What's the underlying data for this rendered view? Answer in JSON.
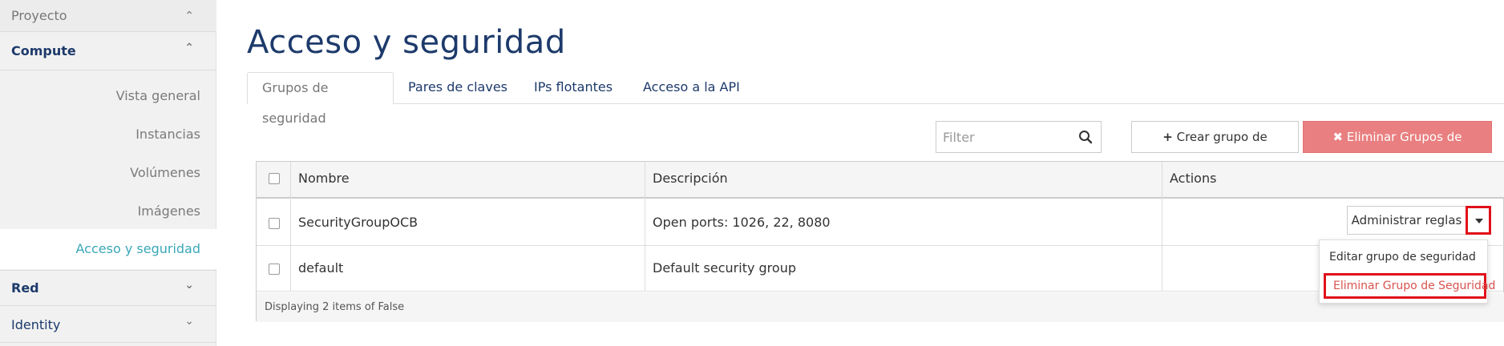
{
  "sidebar": {
    "top_section": "Proyecto",
    "compute": {
      "label": "Compute"
    },
    "items": [
      {
        "label": "Vista general"
      },
      {
        "label": "Instancias"
      },
      {
        "label": "Volúmenes"
      },
      {
        "label": "Imágenes"
      },
      {
        "label": "Acceso y seguridad",
        "active": true
      }
    ],
    "red": {
      "label": "Red"
    },
    "identity": {
      "label": "Identity"
    }
  },
  "main": {
    "title": "Acceso y seguridad",
    "tabs": [
      {
        "label": "Grupos de seguridad",
        "active": true
      },
      {
        "label": "Pares de claves"
      },
      {
        "label": "IPs flotantes"
      },
      {
        "label": "Acceso a la API"
      }
    ],
    "toolbar": {
      "filter_placeholder": "Filter",
      "create_label": "Crear grupo de seguridad",
      "delete_label": "Eliminar Grupos de Seguridad"
    },
    "table": {
      "columns": [
        "Nombre",
        "Descripción",
        "Actions"
      ],
      "rows": [
        {
          "name": "SecurityGroupOCB",
          "description": "Open ports: 1026, 22, 8080"
        },
        {
          "name": "default",
          "description": "Default security group"
        }
      ],
      "footer": "Displaying 2 items of False"
    },
    "actions": {
      "primary_label": "Administrar reglas",
      "menu": [
        {
          "label": "Editar grupo de seguridad"
        },
        {
          "label": "Eliminar Grupo de Seguridad"
        }
      ]
    }
  },
  "colors": {
    "brand_navy": "#1d3a6b",
    "active_teal": "#3aa7b8",
    "danger_button": "#e97f80",
    "highlight_red": "#e0101a"
  },
  "icons": {
    "collapse": "chevron-up-icon",
    "expand": "chevron-down-icon",
    "search": "search-icon",
    "plus": "plus-icon",
    "times": "times-icon",
    "caret": "caret-down-icon"
  }
}
